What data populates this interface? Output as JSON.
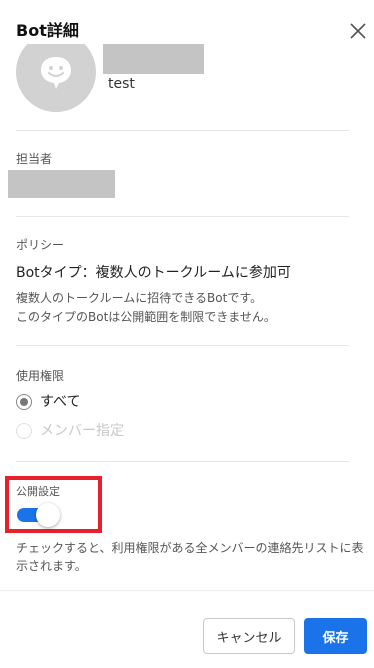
{
  "header": {
    "title": "Bot詳細",
    "close_icon": "close-icon"
  },
  "bot": {
    "name": "test",
    "avatar_icon": "chat-bubble-smile-icon"
  },
  "manager": {
    "label": "担当者"
  },
  "policy": {
    "label": "ポリシー",
    "type": "Botタイプ：複数人のトークルームに参加可",
    "desc_line1": "複数人のトークルームに招待できるBotです。",
    "desc_line2": "このタイプのBotは公開範囲を制限できません。"
  },
  "permission": {
    "label": "使用権限",
    "options": [
      {
        "label": "すべて",
        "checked": true,
        "disabled": false
      },
      {
        "label": "メンバー指定",
        "checked": false,
        "disabled": true
      }
    ]
  },
  "public": {
    "label": "公開設定",
    "enabled": true,
    "desc": "チェックすると、利用権限がある全メンバーの連絡先リストに表示されます。",
    "highlight_color": "#e8202a"
  },
  "footer": {
    "cancel_label": "キャンセル",
    "save_label": "保存"
  },
  "colors": {
    "accent": "#1a73e8"
  }
}
